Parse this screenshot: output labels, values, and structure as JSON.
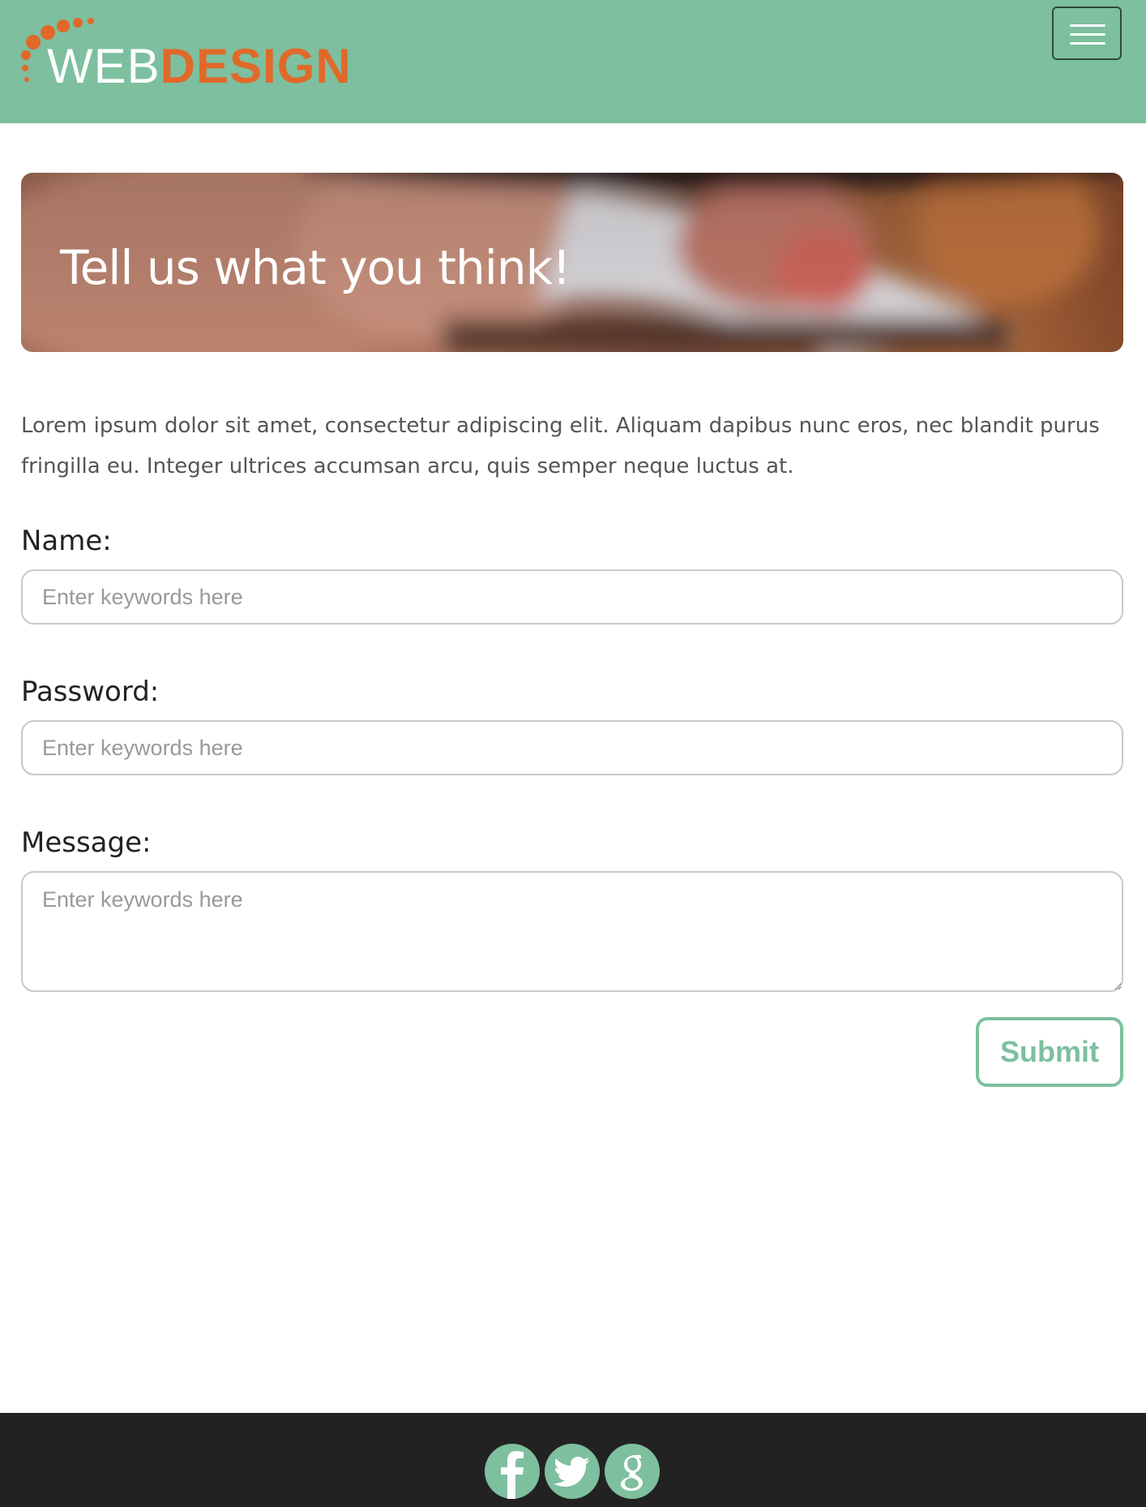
{
  "header": {
    "logo": {
      "part1": "WEB",
      "part2": "DESIGN"
    },
    "menu_icon": "hamburger-menu-icon",
    "colors": {
      "header_bg": "#7dbf9e",
      "logo_accent": "#e0692a"
    }
  },
  "hero": {
    "title": "Tell us what you think!"
  },
  "intro": "Lorem ipsum dolor sit amet, consectetur adipiscing elit. Aliquam dapibus nunc eros, nec blandit purus fringilla eu. Integer ultrices accumsan arcu, quis semper neque luctus at.",
  "form": {
    "name_label": "Name:",
    "name_placeholder": "Enter keywords here",
    "password_label": "Password:",
    "password_placeholder": "Enter keywords here",
    "message_label": "Message:",
    "message_placeholder": "Enter keywords here",
    "submit_label": "Submit"
  },
  "footer": {
    "social_icons": [
      "facebook-icon",
      "twitter-icon",
      "google-icon"
    ],
    "colors": {
      "footer_bg": "#222222",
      "icon_color": "#7dbf9e"
    }
  }
}
